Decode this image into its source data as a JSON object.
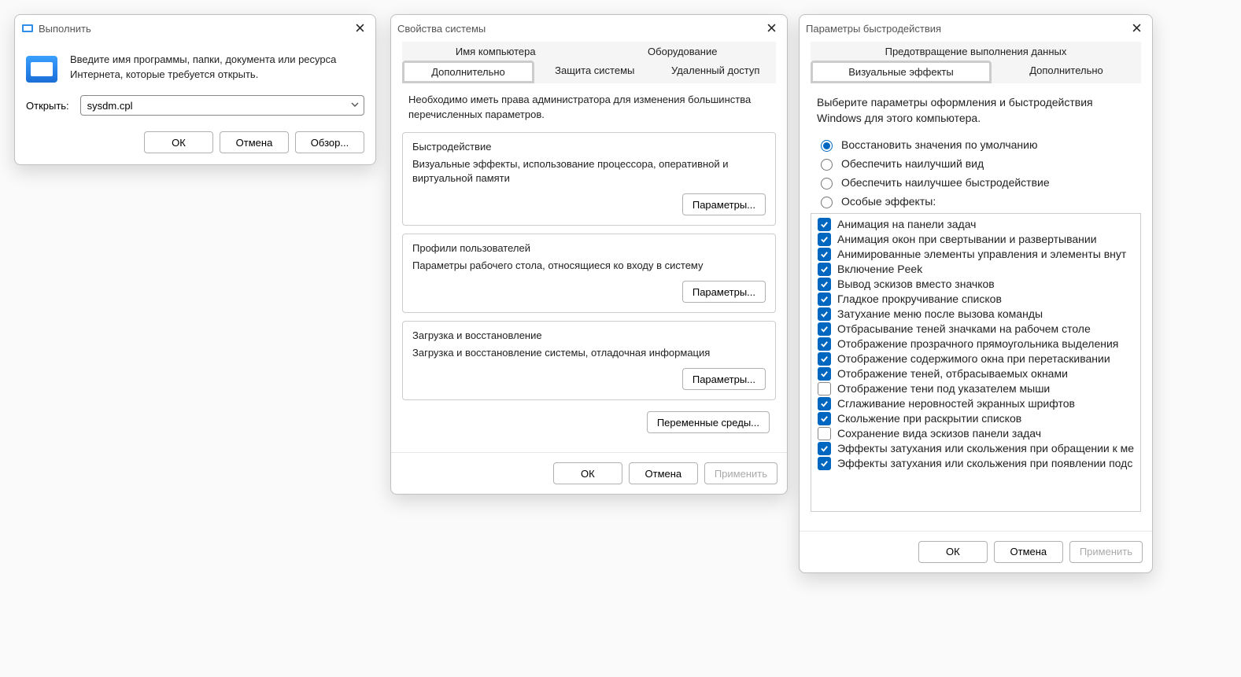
{
  "run": {
    "title": "Выполнить",
    "description": "Введите имя программы, папки, документа или ресурса Интернета, которые требуется открыть.",
    "open_label": "Открыть:",
    "command": "sysdm.cpl",
    "ok": "ОК",
    "cancel": "Отмена",
    "browse": "Обзор..."
  },
  "sys": {
    "title": "Свойства системы",
    "tabs_top": {
      "computer_name": "Имя компьютера",
      "hardware": "Оборудование"
    },
    "tabs_bot": {
      "advanced": "Дополнительно",
      "protection": "Защита системы",
      "remote": "Удаленный доступ"
    },
    "admin_note": "Необходимо иметь права администратора для изменения большинства перечисленных параметров.",
    "perf_group": {
      "title": "Быстродействие",
      "desc": "Визуальные эффекты, использование процессора, оперативной и виртуальной памяти",
      "btn": "Параметры..."
    },
    "profiles_group": {
      "title": "Профили пользователей",
      "desc": "Параметры рабочего стола, относящиеся ко входу в систему",
      "btn": "Параметры..."
    },
    "startup_group": {
      "title": "Загрузка и восстановление",
      "desc": "Загрузка и восстановление системы, отладочная информация",
      "btn": "Параметры..."
    },
    "env_btn": "Переменные среды...",
    "ok": "ОК",
    "cancel": "Отмена",
    "apply": "Применить"
  },
  "perf": {
    "title": "Параметры быстродействия",
    "tab_dep": "Предотвращение выполнения данных",
    "tab_visual": "Визуальные эффекты",
    "tab_adv": "Дополнительно",
    "desc": "Выберите параметры оформления и быстродействия Windows для этого компьютера.",
    "radios": {
      "default": "Восстановить значения по умолчанию",
      "best_look": "Обеспечить наилучший вид",
      "best_perf": "Обеспечить наилучшее быстродействие",
      "custom": "Особые эффекты:"
    },
    "effects": [
      {
        "checked": true,
        "label": "Анимация на панели задач"
      },
      {
        "checked": true,
        "label": "Анимация окон при свертывании и развертывании"
      },
      {
        "checked": true,
        "label": "Анимированные элементы управления и элементы внут"
      },
      {
        "checked": true,
        "label": "Включение Peek"
      },
      {
        "checked": true,
        "label": "Вывод эскизов вместо значков"
      },
      {
        "checked": true,
        "label": "Гладкое прокручивание списков"
      },
      {
        "checked": true,
        "label": "Затухание меню после вызова команды"
      },
      {
        "checked": true,
        "label": "Отбрасывание теней значками на рабочем столе"
      },
      {
        "checked": true,
        "label": "Отображение прозрачного прямоугольника выделения"
      },
      {
        "checked": true,
        "label": "Отображение содержимого окна при перетаскивании"
      },
      {
        "checked": true,
        "label": "Отображение теней, отбрасываемых окнами"
      },
      {
        "checked": false,
        "label": "Отображение тени под указателем мыши"
      },
      {
        "checked": true,
        "label": "Сглаживание неровностей экранных шрифтов"
      },
      {
        "checked": true,
        "label": "Скольжение при раскрытии списков"
      },
      {
        "checked": false,
        "label": "Сохранение вида эскизов панели задач"
      },
      {
        "checked": true,
        "label": "Эффекты затухания или скольжения при обращении к ме"
      },
      {
        "checked": true,
        "label": "Эффекты затухания или скольжения при появлении подс"
      }
    ],
    "ok": "ОК",
    "cancel": "Отмена",
    "apply": "Применить"
  }
}
